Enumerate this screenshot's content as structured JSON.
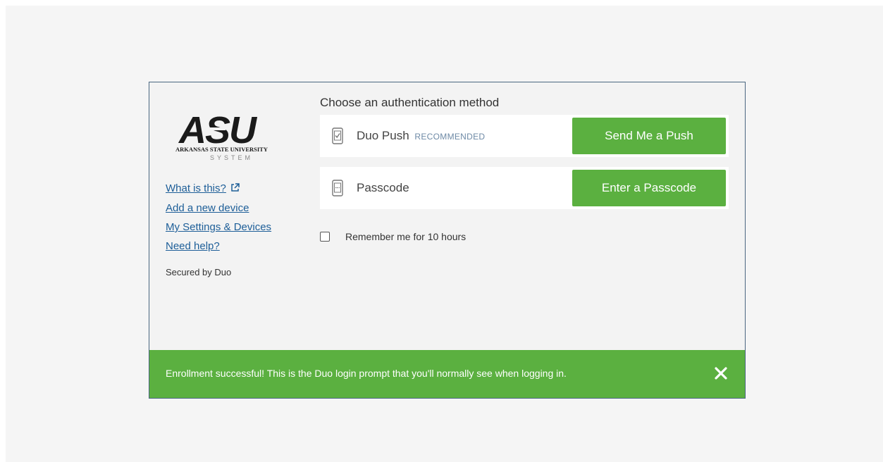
{
  "logo": {
    "letters": "ASU",
    "line1": "ARKANSAS STATE UNIVERSITY",
    "line2": "SYSTEM"
  },
  "sidebar": {
    "links": [
      {
        "label": "What is this?",
        "icon": "external-link-icon"
      },
      {
        "label": "Add a new device"
      },
      {
        "label": "My Settings & Devices"
      },
      {
        "label": "Need help?"
      }
    ],
    "secured_text": "Secured by Duo"
  },
  "auth": {
    "heading": "Choose an authentication method",
    "methods": [
      {
        "label": "Duo Push",
        "badge": "RECOMMENDED",
        "button": "Send Me a Push",
        "icon": "phone-check-icon"
      },
      {
        "label": "Passcode",
        "button": "Enter a Passcode",
        "icon": "phone-keypad-icon"
      }
    ],
    "remember_label": "Remember me for 10 hours",
    "remember_checked": false
  },
  "banner": {
    "text": "Enrollment successful! This is the Duo login prompt that you'll normally see when logging in.",
    "close_icon": "close-icon"
  },
  "colors": {
    "accent_green": "#5bb040",
    "link_blue": "#1d5e98",
    "frame_border": "#4a6680"
  }
}
